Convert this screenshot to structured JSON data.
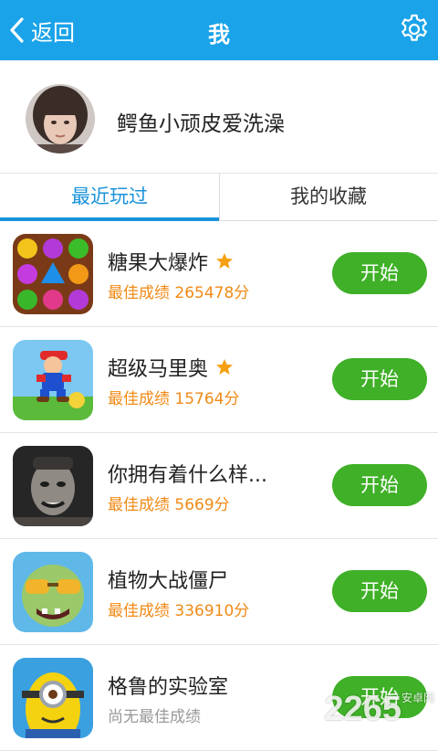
{
  "header": {
    "back_label": "返回",
    "title": "我",
    "settings_icon": "gear-icon",
    "background": "#1aa3e8"
  },
  "profile": {
    "nickname": "鳄鱼小顽皮爱洗澡"
  },
  "tabs": [
    {
      "label": "最近玩过",
      "active": true
    },
    {
      "label": "我的收藏",
      "active": false
    }
  ],
  "games": [
    {
      "name": "糖果大爆炸",
      "starred": true,
      "score": "最佳成绩 265478分",
      "button": "开始"
    },
    {
      "name": "超级马里奥",
      "starred": true,
      "score": "最佳成绩 15764分",
      "button": "开始"
    },
    {
      "name": "你拥有着什么样...",
      "starred": false,
      "score": "最佳成绩 5669分",
      "button": "开始"
    },
    {
      "name": "植物大战僵尸",
      "starred": false,
      "score": "最佳成绩 336910分",
      "button": "开始"
    },
    {
      "name": "格鲁的实验室",
      "starred": false,
      "score": "尚无最佳成绩",
      "button": "开始"
    }
  ],
  "colors": {
    "accent": "#1a93db",
    "score": "#f08a16",
    "start_button": "#3fb027"
  },
  "watermark": {
    "main": "2265",
    "sub": "安卓网"
  }
}
